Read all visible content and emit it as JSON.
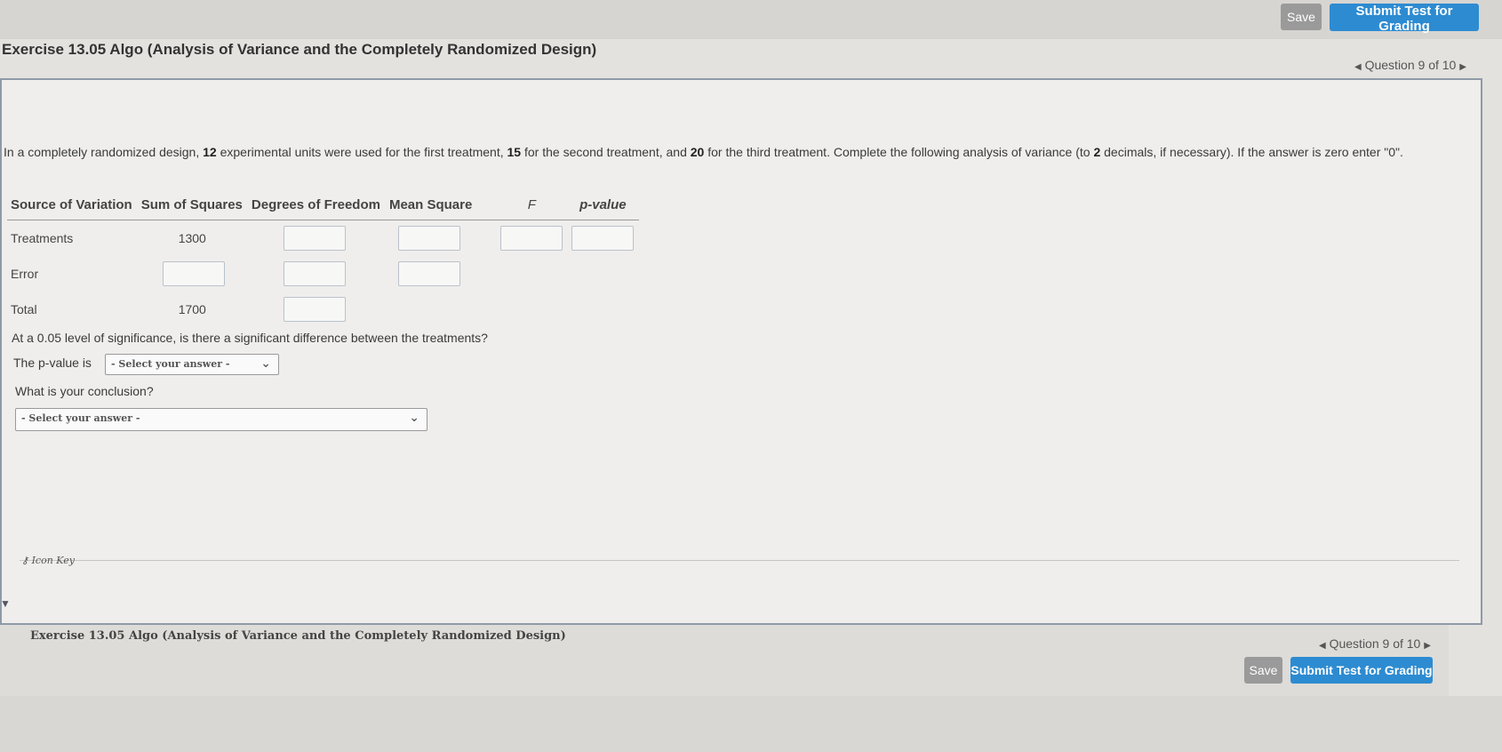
{
  "header": {
    "save_label": "Save",
    "submit_label": "Submit Test for Grading",
    "exercise_title": "Exercise 13.05 Algo (Analysis of Variance and the Completely Randomized Design)",
    "question_nav": "Question 9 of 10"
  },
  "question": {
    "text_part1": "In a completely randomized design, ",
    "n1": "12",
    "text_part2": " experimental units were used for the first treatment, ",
    "n2": "15",
    "text_part3": " for the second treatment, and ",
    "n3": "20",
    "text_part4": " for the third treatment. Complete the following analysis of variance (to ",
    "decimals": "2",
    "text_part5": " decimals, if necessary). If the answer is zero enter \"0\"."
  },
  "anova_table": {
    "headers": [
      "Source of Variation",
      "Sum of Squares",
      "Degrees of Freedom",
      "Mean Square",
      "F",
      "p-value"
    ],
    "rows": [
      {
        "source": "Treatments",
        "sum_of_squares": "1300"
      },
      {
        "source": "Error",
        "sum_of_squares": ""
      },
      {
        "source": "Total",
        "sum_of_squares": "1700"
      }
    ]
  },
  "significance": {
    "question": "At a 0.05 level of significance, is there a significant difference between the treatments?",
    "pvalue_label": "The p-value is",
    "pvalue_select": "- Select your answer -",
    "conclusion_label": "What is your conclusion?",
    "conclusion_select": "- Select your answer -"
  },
  "footer": {
    "icon_key": "Icon Key",
    "exercise_title": "Exercise 13.05 Algo (Analysis of Variance and the Completely Randomized Design)",
    "question_nav": "Question 9 of 10",
    "save_label": "Save",
    "submit_label": "Submit Test for Grading"
  },
  "colors": {
    "submit_button": "#2d8bd1",
    "save_button": "#9a9a9a",
    "panel_border": "#8e9aa7"
  }
}
